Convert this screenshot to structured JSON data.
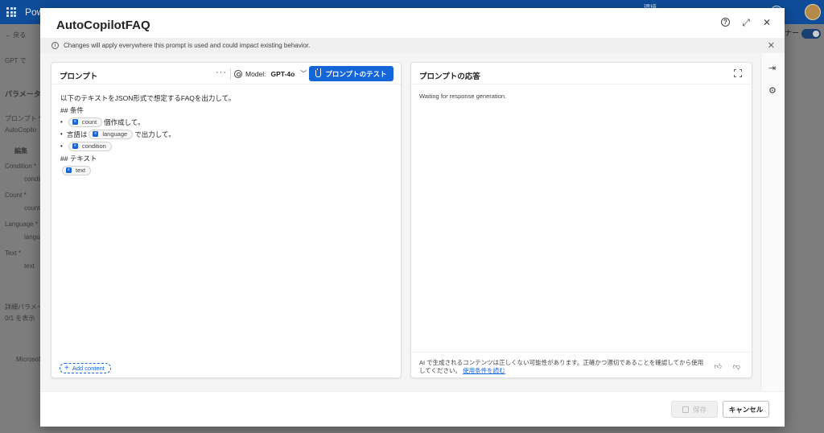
{
  "background": {
    "brand": "Pow",
    "env": "環境",
    "back": "← 戻る",
    "gpt": "GPT で",
    "params": "パラメータ",
    "prompt_label": "プロンプト *",
    "prompt_value": "AutoCopilo",
    "edit": "編集",
    "condition_label": "Condition *",
    "condition_val": "conditi",
    "count_label": "Count *",
    "count_val": "count",
    "language_label": "Language *",
    "language_val": "langua",
    "text_label": "Text *",
    "text_val": "text",
    "advanced": "詳細パラメー",
    "advanced_val": "0/1 を表示",
    "microsoft": "Microsof",
    "right_label": "ナー"
  },
  "dialog": {
    "title": "AutoCopilotFAQ",
    "banner": "Changes will apply everywhere this prompt is used and could impact existing behavior."
  },
  "prompt_panel": {
    "title": "プロンプト",
    "more": "···",
    "model_label": "Model:",
    "model_value": "GPT-4o",
    "test_button": "プロンプトのテスト",
    "lines": {
      "l1": "以下のテキストをJSON形式で想定するFAQを出力して。",
      "l2": "## 条件",
      "l3_after": "個作成して。",
      "l4_before": "言語は",
      "l4_after": "で出力して。",
      "l6": "## テキスト"
    },
    "chips": {
      "count": "count",
      "language": "language",
      "condition": "condition",
      "text": "text"
    },
    "add_content": "Add content"
  },
  "response_panel": {
    "title": "プロンプトの応答",
    "waiting": "Waiting for response generation.",
    "disclaimer": "AI で生成されるコンテンツは正しくない可能性があります。正確かつ適切であることを確認してから使用してください。",
    "terms_link": "使用条件を読む"
  },
  "footer": {
    "save": "保存",
    "cancel": "キャンセル"
  }
}
